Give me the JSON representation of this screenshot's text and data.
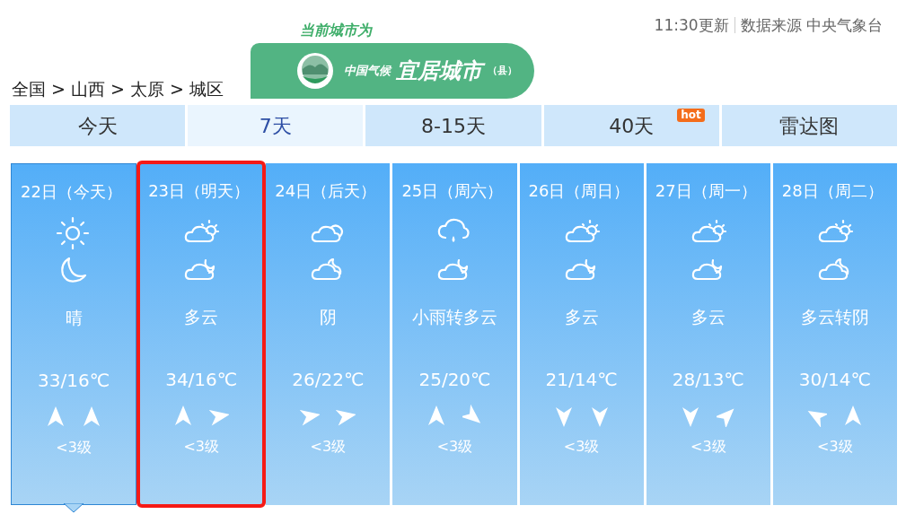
{
  "update": {
    "time": "11:30更新",
    "source": "数据来源 中央气象台"
  },
  "badge": {
    "caption": "当前城市为",
    "prefix": "中国气候",
    "title": "宜居城市",
    "suffix": "（县）"
  },
  "breadcrumb": "全国 > 山西 > 太原 > 城区",
  "tabs": [
    {
      "label": "今天",
      "selected": false
    },
    {
      "label": "7天",
      "selected": true
    },
    {
      "label": "8-15天",
      "selected": false
    },
    {
      "label": "40天",
      "selected": false,
      "tag": "hot"
    },
    {
      "label": "雷达图",
      "selected": false
    }
  ],
  "days": [
    {
      "date": "22日（今天）",
      "day_icon": {
        "kind": "sun"
      },
      "night_icon": {
        "kind": "moon"
      },
      "weather": "晴",
      "temp": "33/16℃",
      "wind": [
        {
          "kind": "up"
        },
        {
          "kind": "up"
        }
      ],
      "wind_level": "<3级",
      "selected": true,
      "highlighted": false
    },
    {
      "date": "23日（明天）",
      "day_icon": {
        "kind": "partlycloudy"
      },
      "night_icon": {
        "kind": "cloudynight"
      },
      "weather": "多云",
      "temp": "34/16℃",
      "wind": [
        {
          "kind": "up"
        },
        {
          "kind": "right"
        }
      ],
      "wind_level": "<3级",
      "selected": false,
      "highlighted": true
    },
    {
      "date": "24日（后天）",
      "day_icon": {
        "kind": "overcast"
      },
      "night_icon": {
        "kind": "overcastnight"
      },
      "weather": "阴",
      "temp": "26/22℃",
      "wind": [
        {
          "kind": "right"
        },
        {
          "kind": "right"
        }
      ],
      "wind_level": "<3级",
      "selected": false,
      "highlighted": false
    },
    {
      "date": "25日（周六）",
      "day_icon": {
        "kind": "rain"
      },
      "night_icon": {
        "kind": "cloudynight"
      },
      "weather": "小雨转多云",
      "temp": "25/20℃",
      "wind": [
        {
          "kind": "up"
        },
        {
          "kind": "downright"
        }
      ],
      "wind_level": "<3级",
      "selected": false,
      "highlighted": false
    },
    {
      "date": "26日（周日）",
      "day_icon": {
        "kind": "partlycloudy"
      },
      "night_icon": {
        "kind": "cloudynight"
      },
      "weather": "多云",
      "temp": "21/14℃",
      "wind": [
        {
          "kind": "down"
        },
        {
          "kind": "down"
        }
      ],
      "wind_level": "<3级",
      "selected": false,
      "highlighted": false
    },
    {
      "date": "27日（周一）",
      "day_icon": {
        "kind": "partlycloudy"
      },
      "night_icon": {
        "kind": "cloudynight"
      },
      "weather": "多云",
      "temp": "28/13℃",
      "wind": [
        {
          "kind": "down"
        },
        {
          "kind": "upright"
        }
      ],
      "wind_level": "<3级",
      "selected": false,
      "highlighted": false
    },
    {
      "date": "28日（周二）",
      "day_icon": {
        "kind": "partlycloudy"
      },
      "night_icon": {
        "kind": "overcastnight"
      },
      "weather": "多云转阴",
      "temp": "30/14℃",
      "wind": [
        {
          "kind": "upleft"
        },
        {
          "kind": "up"
        }
      ],
      "wind_level": "<3级",
      "selected": false,
      "highlighted": false
    }
  ]
}
